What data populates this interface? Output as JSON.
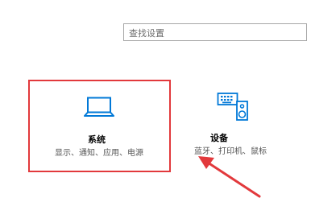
{
  "search": {
    "placeholder": "查找设置"
  },
  "tiles": [
    {
      "title": "系统",
      "description": "显示、通知、应用、电源",
      "icon": "laptop-icon"
    },
    {
      "title": "设备",
      "description": "蓝牙、打印机、鼠标",
      "icon": "keyboard-speaker-icon"
    }
  ],
  "annotations": {
    "highlight_color": "#e2393c",
    "arrow_color": "#e2393c"
  },
  "colors": {
    "accent": "#0078d7"
  }
}
